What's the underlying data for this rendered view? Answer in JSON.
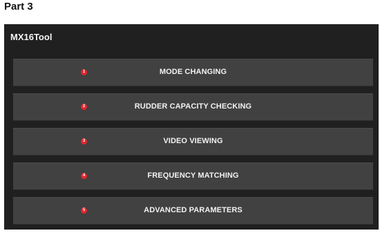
{
  "page": {
    "heading": "Part 3"
  },
  "app": {
    "title": "MX16Tool",
    "background_color": "#202020",
    "button_color": "#414141",
    "badge_color": "#e1262d"
  },
  "menu": {
    "items": [
      {
        "number": "1",
        "label": "MODE CHANGING"
      },
      {
        "number": "2",
        "label": "RUDDER CAPACITY CHECKING"
      },
      {
        "number": "3",
        "label": "VIDEO VIEWING"
      },
      {
        "number": "4",
        "label": "FREQUENCY MATCHING"
      },
      {
        "number": "5",
        "label": "ADVANCED PARAMETERS"
      }
    ]
  }
}
